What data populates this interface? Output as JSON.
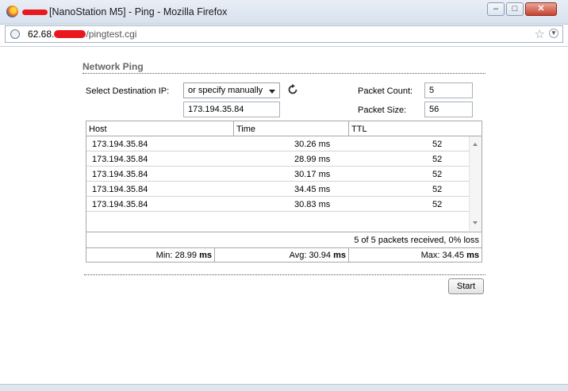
{
  "window": {
    "title": "[NanoStation M5] - Ping - Mozilla Firefox",
    "minimize": "–",
    "maximize": "□",
    "close": "✕"
  },
  "urlbar": {
    "host_prefix": "62.68.",
    "path": "/pingtest.cgi"
  },
  "colors": {
    "redaction": "#e8181e",
    "section_title": "#666666"
  },
  "section": {
    "title": "Network Ping"
  },
  "form": {
    "dest_label": "Select Destination IP:",
    "dest_select_value": "or specify manually",
    "dest_ip_value": "173.194.35.84",
    "packet_count_label": "Packet Count:",
    "packet_count_value": "5",
    "packet_size_label": "Packet Size:",
    "packet_size_value": "56"
  },
  "table": {
    "headers": [
      "Host",
      "Time",
      "TTL"
    ],
    "rows": [
      {
        "host": "173.194.35.84",
        "time": "30.26 ms",
        "ttl": "52"
      },
      {
        "host": "173.194.35.84",
        "time": "28.99 ms",
        "ttl": "52"
      },
      {
        "host": "173.194.35.84",
        "time": "30.17 ms",
        "ttl": "52"
      },
      {
        "host": "173.194.35.84",
        "time": "34.45 ms",
        "ttl": "52"
      },
      {
        "host": "173.194.35.84",
        "time": "30.83 ms",
        "ttl": "52"
      }
    ],
    "summary": "5 of 5 packets received, 0% loss",
    "min_label": "Min: 28.99",
    "avg_label": "Avg: 30.94",
    "max_label": "Max: 34.45",
    "unit": "ms"
  },
  "buttons": {
    "start": "Start"
  },
  "icons": [
    "firefox-icon",
    "globe-icon",
    "refresh-icon",
    "star-icon",
    "dropmarker-icon"
  ]
}
